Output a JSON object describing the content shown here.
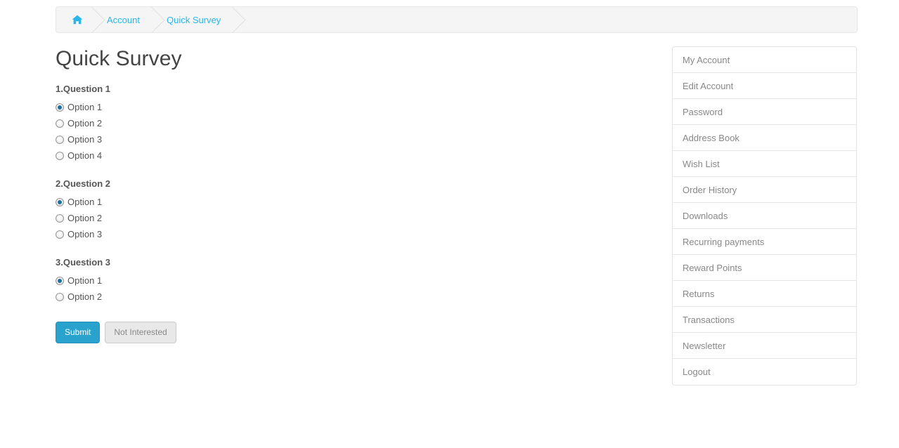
{
  "breadcrumb": {
    "home_icon": "home-icon",
    "items": [
      {
        "label": "Account"
      },
      {
        "label": "Quick Survey"
      }
    ]
  },
  "main": {
    "title": "Quick Survey",
    "questions": [
      {
        "label": "1.Question 1",
        "options": [
          {
            "label": "Option 1",
            "checked": true
          },
          {
            "label": "Option 2",
            "checked": false
          },
          {
            "label": "Option 3",
            "checked": false
          },
          {
            "label": "Option 4",
            "checked": false
          }
        ]
      },
      {
        "label": "2.Question 2",
        "options": [
          {
            "label": "Option 1",
            "checked": true
          },
          {
            "label": "Option 2",
            "checked": false
          },
          {
            "label": "Option 3",
            "checked": false
          }
        ]
      },
      {
        "label": "3.Question 3",
        "options": [
          {
            "label": "Option 1",
            "checked": true
          },
          {
            "label": "Option 2",
            "checked": false
          }
        ]
      }
    ],
    "buttons": {
      "submit": "Submit",
      "not_interested": "Not Interested"
    }
  },
  "sidebar": {
    "items": [
      {
        "label": "My Account"
      },
      {
        "label": "Edit Account"
      },
      {
        "label": "Password"
      },
      {
        "label": "Address Book"
      },
      {
        "label": "Wish List"
      },
      {
        "label": "Order History"
      },
      {
        "label": "Downloads"
      },
      {
        "label": "Recurring payments"
      },
      {
        "label": "Reward Points"
      },
      {
        "label": "Returns"
      },
      {
        "label": "Transactions"
      },
      {
        "label": "Newsletter"
      },
      {
        "label": "Logout"
      }
    ]
  },
  "colors": {
    "link": "#29b6e8",
    "primary_button": "#29a3ce",
    "radio_dot": "#1d6ea3",
    "breadcrumb_bg": "#f5f5f5",
    "text": "#555555",
    "muted_text": "#888888"
  }
}
